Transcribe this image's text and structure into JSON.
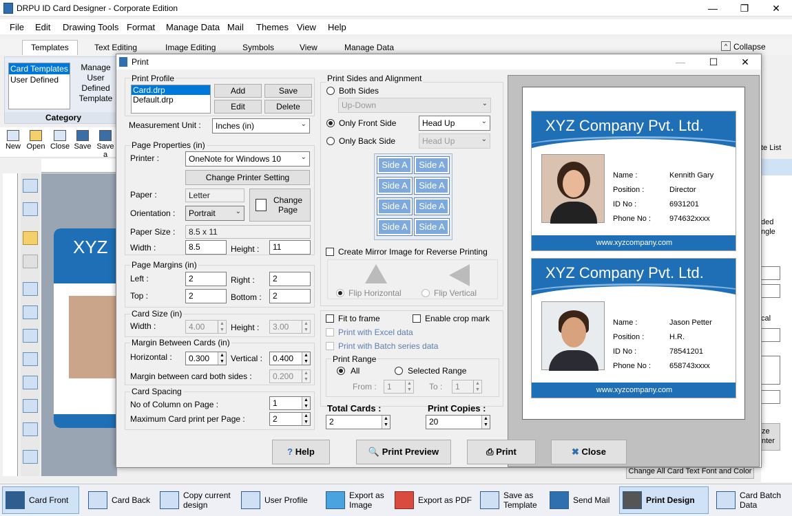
{
  "window": {
    "title": "DRPU ID Card Designer - Corporate Edition"
  },
  "menu": [
    "File",
    "Edit",
    "Drawing Tools",
    "Format",
    "Manage Data",
    "Mail",
    "Themes",
    "View",
    "Help"
  ],
  "ribbon_tabs": [
    "Templates",
    "Text Editing",
    "Image Editing",
    "Symbols",
    "View",
    "Manage Data"
  ],
  "collapse_label": "Collapse",
  "category": {
    "items": [
      "Card Templates",
      "User Defined"
    ],
    "manage_label": "Manage User Defined Template",
    "title": "Category"
  },
  "toolbar": [
    "New",
    "Open",
    "Close",
    "Save",
    "Save a"
  ],
  "right_fragments": {
    "list": "te List",
    "ded": "ded",
    "ngle": "ngle",
    "cal": "cal",
    "ze": "ze",
    "nter": "nter"
  },
  "bottom_strip": "Change All Card Text Font and Color",
  "bg_card_text": "XYZ",
  "dialog": {
    "title": "Print",
    "print_profile": {
      "label": "Print Profile",
      "items": [
        "Card.drp",
        "Default.drp"
      ],
      "add": "Add",
      "save": "Save",
      "edit": "Edit",
      "delete": "Delete"
    },
    "measurement": {
      "label": "Measurement Unit :",
      "value": "Inches (in)"
    },
    "page_props": {
      "label": "Page Properties (in)",
      "printer_label": "Printer :",
      "printer": "OneNote for Windows 10",
      "change_printer": "Change Printer Setting",
      "paper_label": "Paper :",
      "paper": "Letter",
      "orientation_label": "Orientation :",
      "orientation": "Portrait",
      "change_page": "Change Page",
      "paper_size_label": "Paper Size :",
      "paper_size": "8.5 x 11",
      "width_label": "Width :",
      "width": "8.5",
      "height_label": "Height :",
      "height": "11"
    },
    "margins": {
      "label": "Page Margins (in)",
      "left_label": "Left :",
      "left": "2",
      "right_label": "Right :",
      "right": "2",
      "top_label": "Top :",
      "top": "2",
      "bottom_label": "Bottom :",
      "bottom": "2"
    },
    "card_size": {
      "label": "Card Size (in)",
      "width_label": "Width :",
      "width": "4.00",
      "height_label": "Height :",
      "height": "3.00"
    },
    "margin_between": {
      "label": "Margin Between Cards (in)",
      "h_label": "Horizontal :",
      "h": "0.300",
      "v_label": "Vertical :",
      "v": "0.400",
      "both_label": "Margin between card both sides :",
      "both": "0.200"
    },
    "spacing": {
      "label": "Card Spacing",
      "cols_label": "No of Column on Page :",
      "cols": "1",
      "max_label": "Maximum Card print per Page :",
      "max": "2"
    },
    "sides": {
      "label": "Print Sides and Alignment",
      "both": "Both Sides",
      "both_combo": "Up-Down",
      "front": "Only Front Side",
      "front_combo": "Head Up",
      "back": "Only Back Side",
      "back_combo": "Head Up",
      "side_label": "Side A",
      "mirror": "Create Mirror Image for Reverse Printing",
      "flip_h": "Flip Horizontal",
      "flip_v": "Flip Vertical"
    },
    "options": {
      "fit": "Fit to frame",
      "crop": "Enable crop mark",
      "excel": "Print with Excel data",
      "batch": "Print with Batch series data"
    },
    "range": {
      "label": "Print Range",
      "all": "All",
      "selected": "Selected Range",
      "from_label": "From :",
      "from": "1",
      "to_label": "To :",
      "to": "1"
    },
    "totals": {
      "total_label": "Total Cards :",
      "total": "2",
      "copies_label": "Print Copies :",
      "copies": "20"
    },
    "buttons": {
      "help": "Help",
      "preview": "Print Preview",
      "print": "Print",
      "close": "Close"
    }
  },
  "cards": [
    {
      "company": "XYZ Company Pvt. Ltd.",
      "name": "Kennith Gary",
      "position": "Director",
      "id": "6931201",
      "phone": "974632xxxx",
      "web": "www.xyzcompany.com"
    },
    {
      "company": "XYZ Company Pvt. Ltd.",
      "name": "Jason Petter",
      "position": "H.R.",
      "id": "78541201",
      "phone": "658743xxxx",
      "web": "www.xyzcompany.com"
    }
  ],
  "card_labels": {
    "name": "Name :",
    "position": "Position :",
    "id": "ID No :",
    "phone": "Phone No :"
  },
  "taskbar": [
    "Card Front",
    "Card Back",
    "Copy current design",
    "User Profile",
    "Export as Image",
    "Export as PDF",
    "Save as Template",
    "Send Mail",
    "Print Design",
    "Card Batch Data"
  ]
}
